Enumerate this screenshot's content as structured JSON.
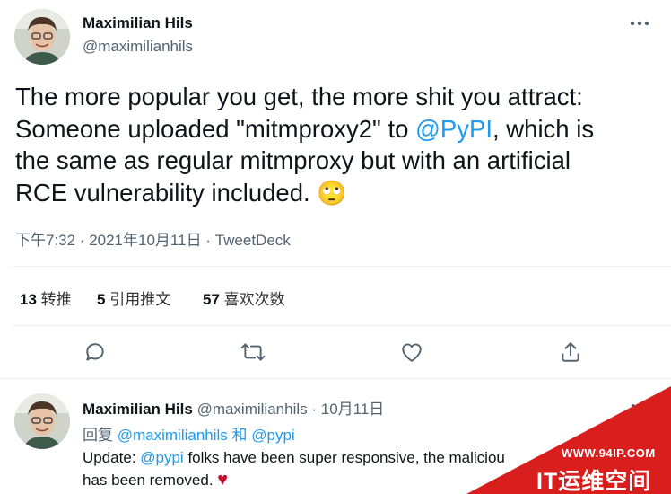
{
  "tweet": {
    "author_name": "Maximilian Hils",
    "author_handle": "@maximilianhils",
    "text_line1": "The more popular you get, the more shit you attract:",
    "text_line2_pre": "Someone uploaded \"mitmproxy2\" to ",
    "text_line2_mention": "@PyPI",
    "text_line2_post": ", which is",
    "text_line3": "the same as regular mitmproxy but with an artificial",
    "text_line4": "RCE vulnerability included.",
    "emoji": "🙄",
    "timestamp": "下午7:32 · 2021年10月11日",
    "separator": " · ",
    "source": "TweetDeck",
    "stats": {
      "retweets_count": "13",
      "retweets_label": "转推",
      "quotes_count": "5",
      "quotes_label": "引用推文",
      "likes_count": "57",
      "likes_label": "喜欢次数"
    },
    "actions": [
      "reply-icon",
      "retweet-icon",
      "like-icon",
      "share-icon"
    ]
  },
  "reply": {
    "author_name": "Maximilian Hils",
    "author_handle": "@maximilianhils",
    "dot": " · ",
    "date": "10月11日",
    "replying_prefix": "回复",
    "replying_user1": "@maximilianhils",
    "replying_and": "和",
    "replying_user2": "@pypi",
    "text_line1_pre": "Update: ",
    "text_line1_mention": "@pypi",
    "text_line1_post": " folks have been super responsive, the maliciou",
    "text_line2": "has been removed.",
    "heart": "♥"
  },
  "watermark": {
    "url": "WWW.94IP.COM",
    "title": "IT运维空间"
  },
  "colors": {
    "link": "#1d9bf0",
    "muted": "#536471",
    "text": "#0f1419",
    "heart": "#c8102e",
    "watermark_red": "#d91e1e"
  }
}
